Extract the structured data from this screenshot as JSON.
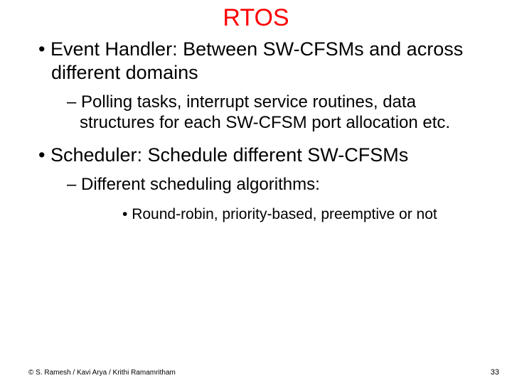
{
  "slide": {
    "title": "RTOS",
    "bullets": {
      "l1a": "Event Handler: Between SW-CFSMs and across different domains",
      "l2a": "Polling tasks, interrupt service routines, data structures for each SW-CFSM port allocation etc.",
      "l1b": "Scheduler: Schedule different SW-CFSMs",
      "l2b": "Different scheduling algorithms:",
      "l3a": "Round-robin, priority-based, preemptive or not"
    },
    "footer": {
      "copyright": "© S. Ramesh / Kavi Arya / Krithi Ramamritham",
      "page": "33"
    }
  }
}
